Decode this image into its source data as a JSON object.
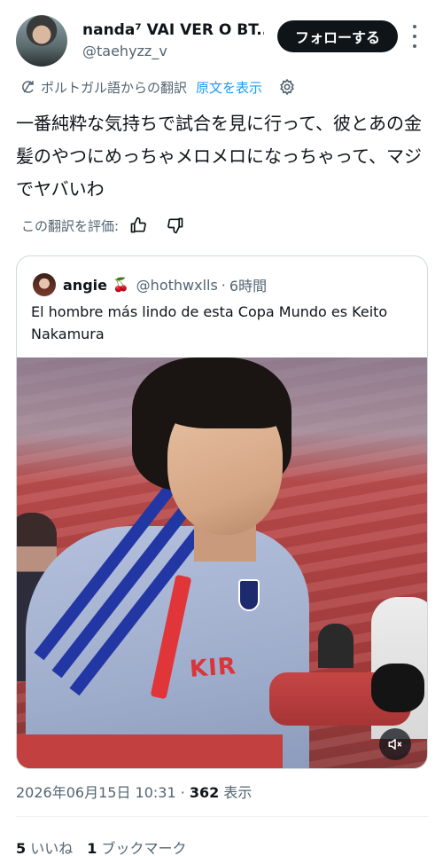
{
  "author": {
    "display_name": "nanda⁷ VAI VER O BT...",
    "handle": "@taehyzz_v"
  },
  "follow_button": "フォローする",
  "translation": {
    "label": "ポルトガル語からの翻訳",
    "show_original": "原文を表示"
  },
  "tweet": {
    "text": "一番純粋な気持ちで試合を見に行って、彼とあの金髪のやつにめっちゃメロメロになっちゃって、マジでヤバいわ"
  },
  "rating": {
    "label": "この翻訳を評価:"
  },
  "quote": {
    "name": "angie",
    "emoji": "🍒",
    "handle": "@hothwxlls",
    "separator": "·",
    "time": "6時間",
    "text": "El hombre más lindo de esta Copa Mundo es Keito Nakamura",
    "video": {
      "sponsor_text": "KIR",
      "mute_icon": "speaker-muted-icon"
    }
  },
  "meta": {
    "timestamp": "2026年06月15日 10:31",
    "separator": " · ",
    "views_count": "362",
    "views_label": " 表示"
  },
  "stats": {
    "likes_count": "5",
    "likes_label": " いいね",
    "bookmarks_count": "1",
    "bookmarks_label": " ブックマーク"
  },
  "colors": {
    "accent": "#1d9bf0",
    "text": "#0f1419",
    "secondary": "#536471",
    "border": "#cfd9de"
  }
}
